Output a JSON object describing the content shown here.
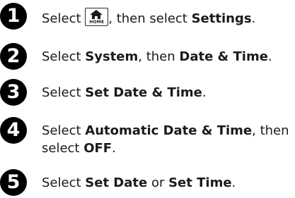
{
  "steps": [
    {
      "number": "1",
      "pre": "Select ",
      "icon_name": "home-icon",
      "icon_label": "HOME",
      "mid": ", then select ",
      "b1": "Settings",
      "post": "."
    },
    {
      "number": "2",
      "pre": "Select ",
      "b1": "System",
      "mid": ", then ",
      "b2": "Date & Time",
      "post": "."
    },
    {
      "number": "3",
      "pre": "Select ",
      "b1": "Set Date & Time",
      "post": "."
    },
    {
      "number": "4",
      "pre": "Select ",
      "b1": "Automatic Date & Time",
      "mid": ", then select ",
      "b2": "OFF",
      "post": "."
    },
    {
      "number": "5",
      "pre": "Select ",
      "b1": "Set Date",
      "mid": " or ",
      "b2": "Set Time",
      "post": "."
    }
  ]
}
